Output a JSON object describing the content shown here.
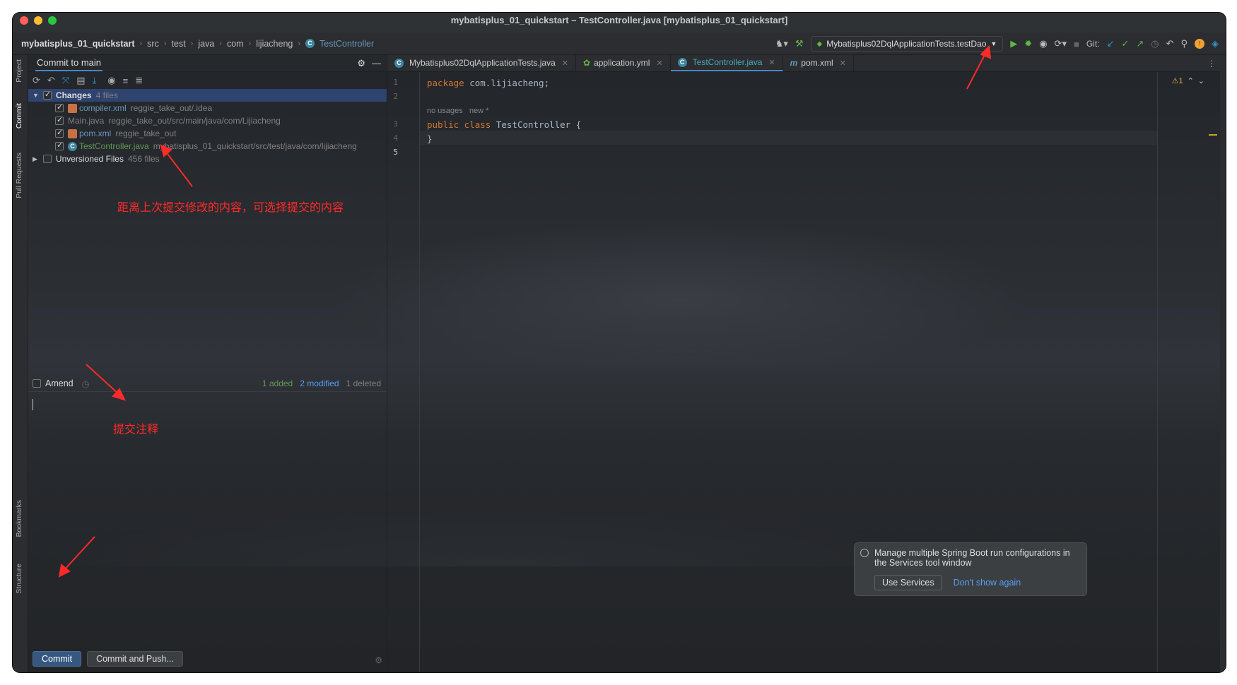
{
  "window": {
    "title": "mybatisplus_01_quickstart – TestController.java [mybatisplus_01_quickstart]"
  },
  "breadcrumb": [
    "mybatisplus_01_quickstart",
    "src",
    "test",
    "java",
    "com",
    "lijiacheng",
    "TestController"
  ],
  "toolbar": {
    "run_config": "Mybatisplus02DqlApplicationTests.testDao",
    "git_label": "Git:"
  },
  "side_tabs": [
    "Project",
    "Commit",
    "Pull Requests",
    "Bookmarks",
    "Structure"
  ],
  "commit_panel": {
    "title": "Commit to main",
    "changes": {
      "label": "Changes",
      "count": "4 files"
    },
    "files": [
      {
        "name": "compiler.xml",
        "path": "reggie_take_out/.idea",
        "color": "#6897bb"
      },
      {
        "name": "Main.java",
        "path": "reggie_take_out/src/main/java/com/Lijiacheng",
        "color": "#808080"
      },
      {
        "name": "pom.xml",
        "path": "reggie_take_out",
        "color": "#6897bb"
      },
      {
        "name": "TestController.java",
        "path": "mybatisplus_01_quickstart/src/test/java/com/lijiacheng",
        "color": "#629755"
      }
    ],
    "unversioned": {
      "label": "Unversioned Files",
      "count": "456 files"
    },
    "amend_label": "Amend",
    "stats": {
      "added": "1 added",
      "modified": "2 modified",
      "deleted": "1 deleted"
    },
    "commit_button": "Commit",
    "commit_push_button": "Commit and Push..."
  },
  "annotations": {
    "changes_note": "距离上次提交修改的内容，可选择提交的内容",
    "message_note": "提交注释"
  },
  "editor": {
    "tabs": [
      {
        "label": "Mybatisplus02DqlApplicationTests.java",
        "active": false
      },
      {
        "label": "application.yml",
        "active": false
      },
      {
        "label": "TestController.java",
        "active": true
      },
      {
        "label": "pom.xml",
        "active": false
      }
    ],
    "line_numbers": [
      "1",
      "2",
      "3",
      "4",
      "5"
    ],
    "code": {
      "line1_kw": "package",
      "line1_rest": " com.lijiacheng;",
      "hint_usages": "no usages",
      "hint_new": "new *",
      "line3_kw": "public class",
      "line3_rest": " TestController {",
      "line4": "}"
    },
    "warnings": "⚠1"
  },
  "notification": {
    "text": "Manage multiple Spring Boot run configurations in the Services tool window",
    "primary": "Use Services",
    "secondary": "Don't show again"
  },
  "colors": {
    "accent": "#4a88c7",
    "annotation": "#ff2a2a",
    "added": "#629755",
    "modified": "#589df6"
  }
}
